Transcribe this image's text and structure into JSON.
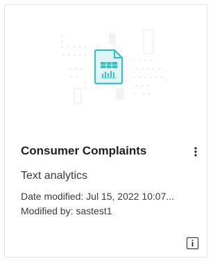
{
  "card": {
    "title": "Consumer Complaints",
    "type_label": "Text analytics",
    "date_modified": "Date modified: Jul 15, 2022 10:07...",
    "modified_by": "Modified by: sastest1"
  },
  "colors": {
    "accent": "#3bbfc0",
    "text_primary": "#1f1f1f",
    "text_secondary": "#3a3a3a",
    "border": "#e6e6e6"
  },
  "icons": {
    "thumbnail": "report-document-icon",
    "more": "more-vertical-icon",
    "info": "info-icon"
  }
}
